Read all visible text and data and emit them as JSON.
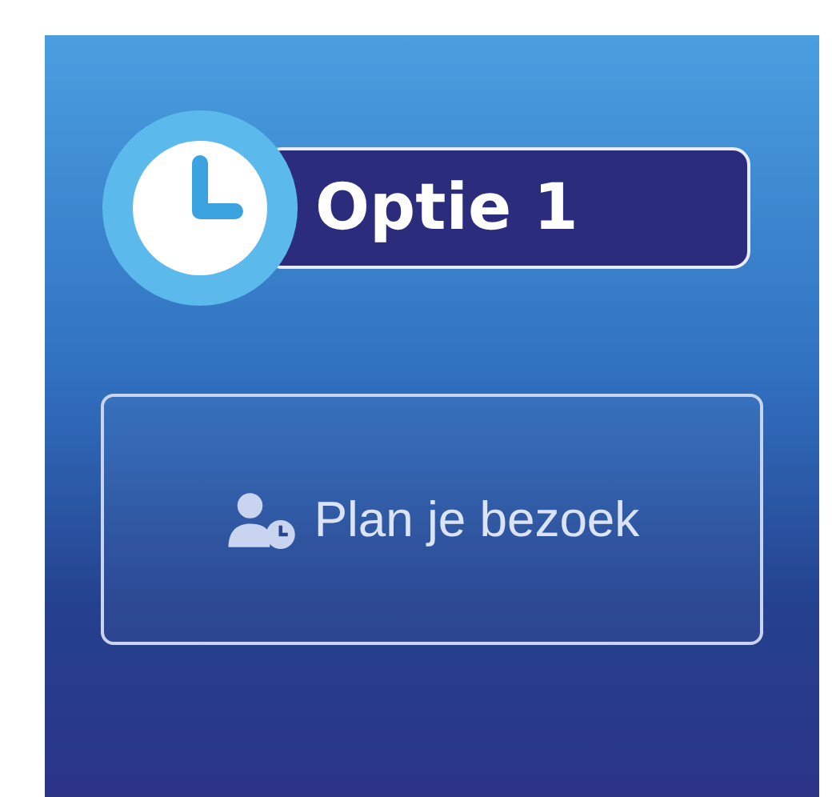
{
  "option_badge": {
    "label": "Optie 1"
  },
  "visit_button": {
    "label": "Plan je bezoek"
  }
}
